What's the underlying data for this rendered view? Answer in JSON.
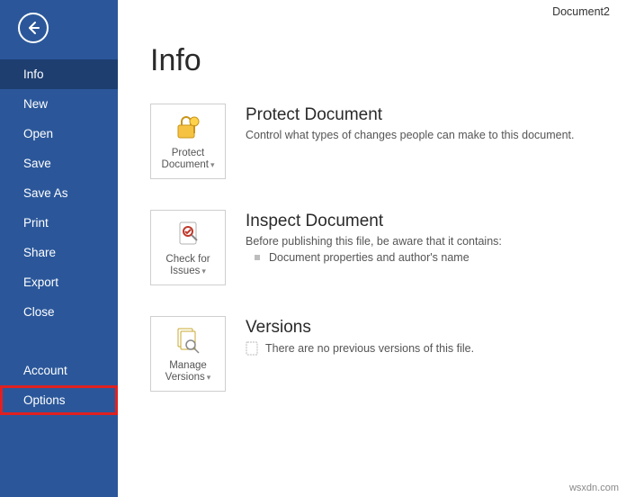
{
  "doc_title": "Document2",
  "page_title": "Info",
  "sidebar": {
    "items": [
      {
        "label": "Info",
        "active": true
      },
      {
        "label": "New"
      },
      {
        "label": "Open"
      },
      {
        "label": "Save"
      },
      {
        "label": "Save As"
      },
      {
        "label": "Print"
      },
      {
        "label": "Share"
      },
      {
        "label": "Export"
      },
      {
        "label": "Close"
      }
    ],
    "lower": [
      {
        "label": "Account"
      },
      {
        "label": "Options",
        "highlight": true
      }
    ]
  },
  "sections": {
    "protect": {
      "tile_line1": "Protect",
      "tile_line2": "Document",
      "heading": "Protect Document",
      "desc": "Control what types of changes people can make to this document."
    },
    "inspect": {
      "tile_line1": "Check for",
      "tile_line2": "Issues",
      "heading": "Inspect Document",
      "desc": "Before publishing this file, be aware that it contains:",
      "bullet": "Document properties and author's name"
    },
    "versions": {
      "tile_line1": "Manage",
      "tile_line2": "Versions",
      "heading": "Versions",
      "desc": "There are no previous versions of this file."
    }
  },
  "watermark": "wsxdn.com"
}
